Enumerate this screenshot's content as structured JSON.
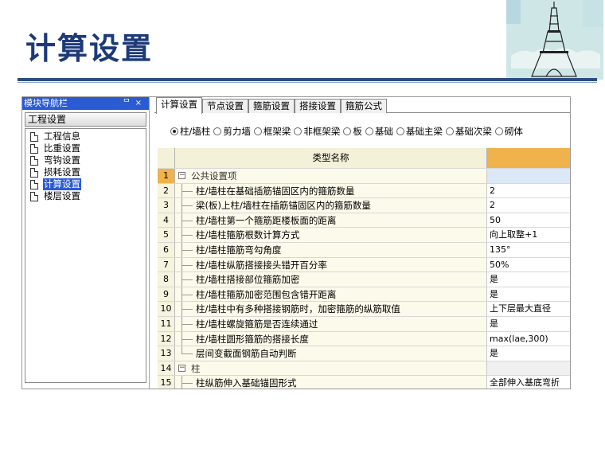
{
  "slide": {
    "title": "计算设置"
  },
  "nav": {
    "title": "模块导航栏",
    "pin": "ᄆ",
    "close": "×",
    "section": "工程设置",
    "items": [
      {
        "label": "工程信息",
        "selected": false
      },
      {
        "label": "比重设置",
        "selected": false
      },
      {
        "label": "弯钩设置",
        "selected": false
      },
      {
        "label": "损耗设置",
        "selected": false
      },
      {
        "label": "计算设置",
        "selected": true
      },
      {
        "label": "楼层设置",
        "selected": false
      }
    ]
  },
  "tabs": [
    "计算设置",
    "节点设置",
    "箍筋设置",
    "搭接设置",
    "箍筋公式"
  ],
  "radios": [
    {
      "label": "柱/墙柱",
      "checked": true
    },
    {
      "label": "剪力墙",
      "checked": false
    },
    {
      "label": "框架梁",
      "checked": false
    },
    {
      "label": "非框架梁",
      "checked": false
    },
    {
      "label": "板",
      "checked": false
    },
    {
      "label": "基础",
      "checked": false
    },
    {
      "label": "基础主梁",
      "checked": false
    },
    {
      "label": "基础次梁",
      "checked": false
    },
    {
      "label": "砌体",
      "checked": false
    }
  ],
  "grid": {
    "header": {
      "name": "类型名称",
      "value": ""
    },
    "rows": [
      {
        "num": "1",
        "name": "公共设置项",
        "value": "",
        "group": true,
        "selected": true
      },
      {
        "num": "2",
        "name": "柱/墙柱在基础插筋锚固区内的箍筋数量",
        "value": "2"
      },
      {
        "num": "3",
        "name": "梁(板)上柱/墙柱在插筋锚固区内的箍筋数量",
        "value": "2"
      },
      {
        "num": "4",
        "name": "柱/墙柱第一个箍筋距楼板面的距离",
        "value": "50"
      },
      {
        "num": "5",
        "name": "柱/墙柱箍筋根数计算方式",
        "value": "向上取整+1"
      },
      {
        "num": "6",
        "name": "柱/墙柱箍筋弯勾角度",
        "value": "135°"
      },
      {
        "num": "7",
        "name": "柱/墙柱纵筋搭接接头错开百分率",
        "value": "50%"
      },
      {
        "num": "8",
        "name": "柱/墙柱搭接部位箍筋加密",
        "value": "是"
      },
      {
        "num": "9",
        "name": "柱/墙柱箍筋加密范围包含错开距离",
        "value": "是"
      },
      {
        "num": "10",
        "name": "柱/墙柱中有多种搭接钢筋时，加密箍筋的纵筋取值",
        "value": "上下层最大直径"
      },
      {
        "num": "11",
        "name": "柱/墙柱螺旋箍筋是否连续通过",
        "value": "是"
      },
      {
        "num": "12",
        "name": "柱/墙柱圆形箍筋的搭接长度",
        "value": "max(lae,300)"
      },
      {
        "num": "13",
        "name": "层间变截面钢筋自动判断",
        "value": "是"
      },
      {
        "num": "14",
        "name": "柱",
        "value": "",
        "group": true
      },
      {
        "num": "15",
        "name": "柱纵筋伸入基础锚固形式",
        "value": "全部伸入基底弯折"
      }
    ]
  },
  "colors": {
    "titleBlue": "#1d3a78",
    "navSelect": "#2a5bd3",
    "headerOrange": "#f0b24a",
    "gridCream": "#fcfaea"
  }
}
